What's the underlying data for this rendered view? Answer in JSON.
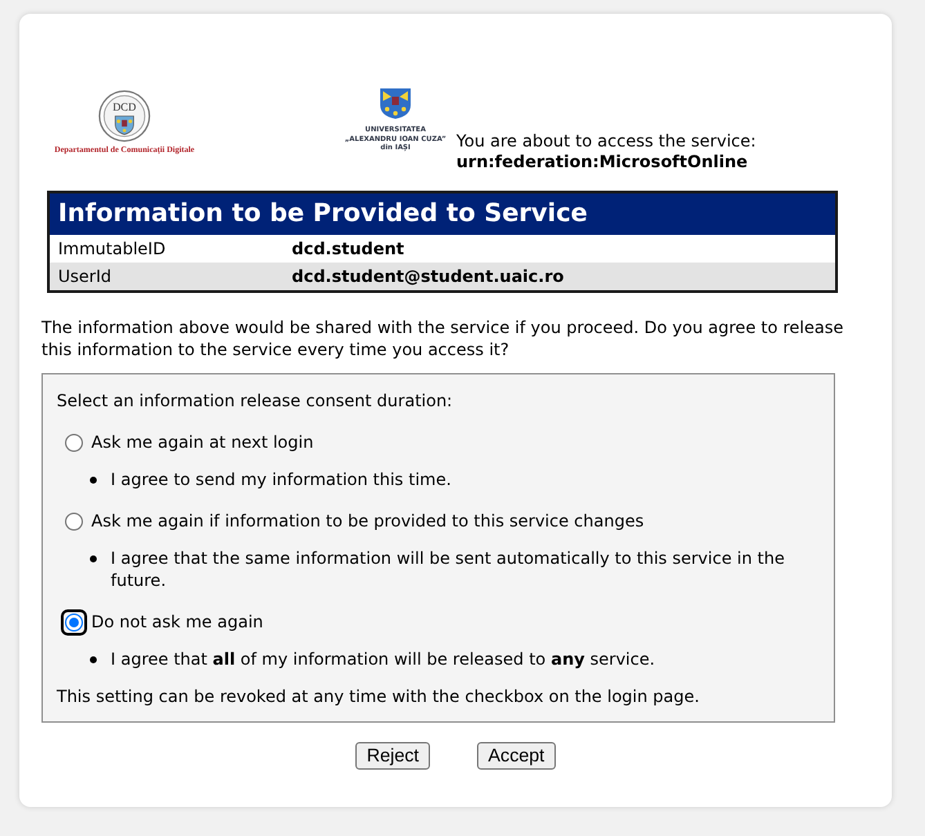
{
  "logos": [
    {
      "kind": "seal",
      "mark": "DCD",
      "caption_lines": [
        "Departamentul de Comunicații Digitale"
      ]
    },
    {
      "kind": "crest",
      "caption_lines": [
        "UNIVERSITATEA",
        "„ALEXANDRU IOAN CUZA”",
        "din IAȘI"
      ]
    }
  ],
  "service_intro": {
    "text": "You are about to access the service:",
    "service": "urn:federation:MicrosoftOnline"
  },
  "attributes_table": {
    "title": "Information to be Provided to Service",
    "rows": [
      {
        "name": "ImmutableID",
        "value": "dcd.student"
      },
      {
        "name": "UserId",
        "value": "dcd.student@student.uaic.ro"
      }
    ]
  },
  "question": "The information above would be shared with the service if you proceed. Do you agree to release this information to the service every time you access it?",
  "consent": {
    "prompt": "Select an information release consent duration:",
    "options": [
      {
        "label": "Ask me again at next login",
        "selected": false,
        "focused": false,
        "note": "I agree to send my information this time."
      },
      {
        "label": "Ask me again if information to be provided to this service changes",
        "selected": false,
        "focused": false,
        "note": "I agree that the same information will be sent automatically to this service in the future."
      },
      {
        "label": "Do not ask me again",
        "selected": true,
        "focused": true,
        "note": "I agree that **all** of my information will be released to **any** service."
      }
    ],
    "footnote": "This setting can be revoked at any time with the checkbox on the login page."
  },
  "buttons": [
    {
      "label": "Reject"
    },
    {
      "label": "Accept"
    }
  ]
}
